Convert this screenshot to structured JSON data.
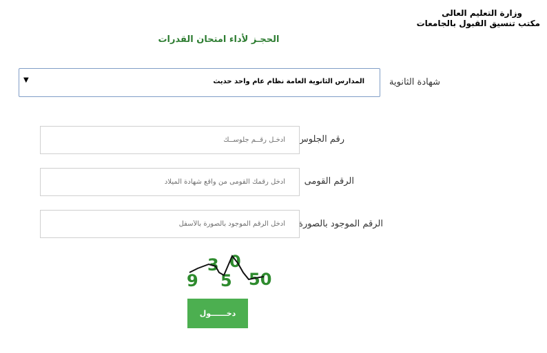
{
  "header": {
    "ministry_line1": "وزارة التعليم العالى",
    "ministry_line2": "مكتب تنسيق القبول بالجامعات",
    "page_title": "الحجـز لأداء امتحان القدرات"
  },
  "form": {
    "certificate": {
      "label": "شهادة الثانوية",
      "selected": "المدارس الثانوية العامة نظام عام واحد حديث",
      "arrow": "▼"
    },
    "seat_number": {
      "label": "رقم الجلوس",
      "placeholder": "أدخـل رقــم جلوســك"
    },
    "national_id": {
      "label": "الرقم القومى",
      "placeholder": "أدخل رقمك القومى من واقع شهادة الميلاد"
    },
    "captcha_input": {
      "label": "الرقم الموجود بالصورة",
      "placeholder": "أدخل الرقم الموجود بالصورة بالأسفل"
    },
    "captcha_image": {
      "digits": [
        "9",
        "3",
        "5",
        "0",
        "50"
      ],
      "color": "#2e8b2e"
    },
    "submit_label": "دخــــــول"
  },
  "colors": {
    "title_green": "#2e7d32",
    "button_green": "#4caf50",
    "select_border": "#7f9cc6"
  }
}
